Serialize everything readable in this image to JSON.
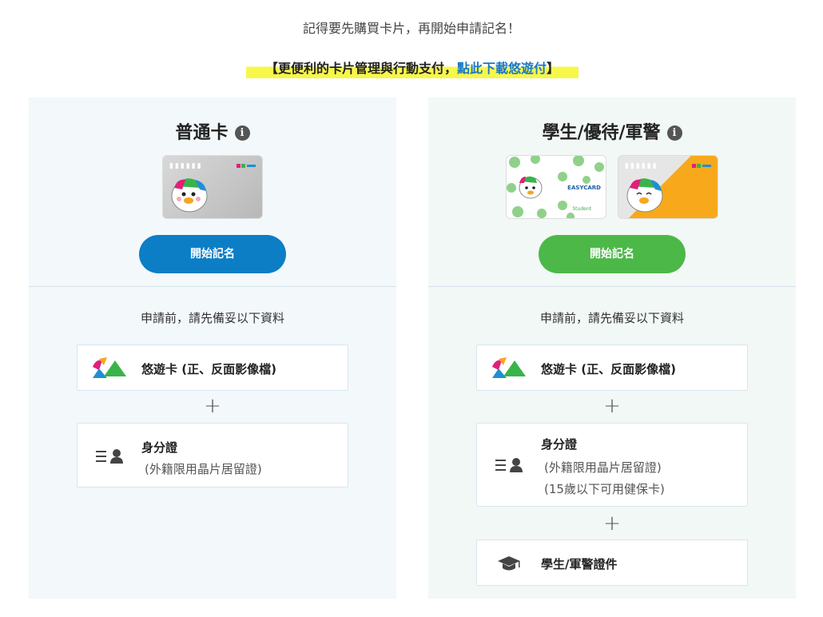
{
  "notice": "記得要先購買卡片，再開始申請記名！",
  "promo": {
    "prefix": "【更便利的卡片管理與行動支付，",
    "link": "點此下載悠遊付",
    "suffix": "】"
  },
  "panels": [
    {
      "title": "普通卡",
      "button": "開始記名",
      "prep": "申請前，請先備妥以下資料",
      "items": [
        {
          "label": "悠遊卡 (正、反面影像檔)"
        },
        {
          "label": "身分證",
          "notes": [
            "(外籍限用晶片居留證)"
          ]
        }
      ]
    },
    {
      "title": "學生/優待/軍警",
      "button": "開始記名",
      "prep": "申請前，請先備妥以下資料",
      "items": [
        {
          "label": "悠遊卡 (正、反面影像檔)"
        },
        {
          "label": "身分證",
          "notes": [
            "(外籍限用晶片居留證)",
            "(15歲以下可用健保卡)"
          ]
        },
        {
          "label": "學生/軍警證件"
        }
      ]
    }
  ],
  "card_text": {
    "easycard": "EASYCARD",
    "student": "Student"
  },
  "plus_sign": "+",
  "colors": {
    "blue_button": "#0b7ec6",
    "green_button": "#4cb848",
    "link": "#1a78c8",
    "highlight": "#f7f74a"
  },
  "icons": {
    "info": "info-icon",
    "easycard_logo": "easycard-logo-icon",
    "id_card": "id-card-icon",
    "graduation_cap": "graduation-cap-icon"
  }
}
